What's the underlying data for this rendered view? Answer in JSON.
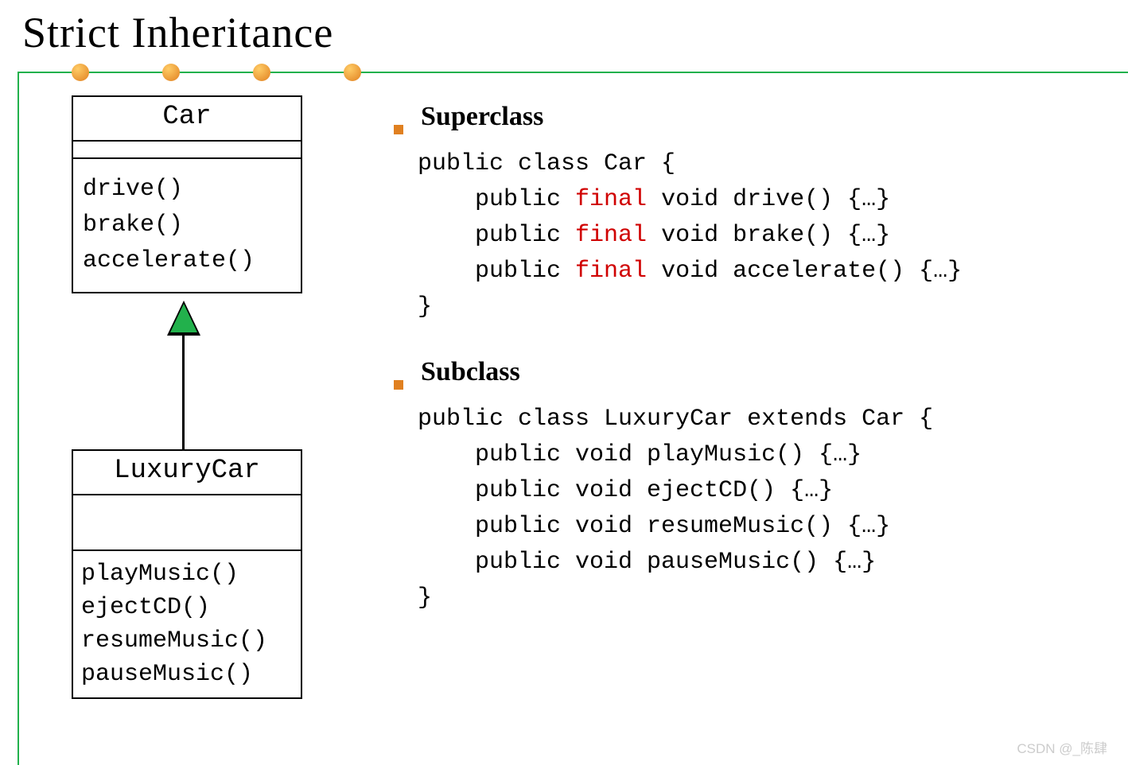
{
  "title": "Strict  Inheritance",
  "uml": {
    "car": {
      "name": "Car",
      "methods": [
        "drive()",
        "brake()",
        "accelerate()"
      ]
    },
    "luxury": {
      "name": "LuxuryCar",
      "methods": [
        "playMusic()",
        "ejectCD()",
        "resumeMusic()",
        "pauseMusic()"
      ]
    }
  },
  "sections": {
    "superclass": {
      "heading": "Superclass",
      "code": {
        "l1": "public class Car {",
        "l2a": "    public ",
        "l2b": "final",
        "l2c": " void drive() {…}",
        "l3a": "    public ",
        "l3b": "final",
        "l3c": " void brake() {…}",
        "l4a": "    public ",
        "l4b": "final",
        "l4c": " void accelerate() {…}",
        "l5": "}"
      }
    },
    "subclass": {
      "heading": "Subclass",
      "code": {
        "l1": "public class LuxuryCar extends Car {",
        "l2": "    public void playMusic() {…}",
        "l3": "    public void ejectCD() {…}",
        "l4": "    public void resumeMusic() {…}",
        "l5": "    public void pauseMusic() {…}",
        "l6": "}"
      }
    }
  },
  "watermark": "CSDN @_陈肆",
  "chart_data": {
    "type": "diagram",
    "description": "UML class inheritance diagram",
    "classes": [
      {
        "name": "Car",
        "stereotype": "superclass",
        "methods": [
          "drive()",
          "brake()",
          "accelerate()"
        ],
        "method_modifier": "final"
      },
      {
        "name": "LuxuryCar",
        "stereotype": "subclass",
        "extends": "Car",
        "methods": [
          "playMusic()",
          "ejectCD()",
          "resumeMusic()",
          "pauseMusic()"
        ]
      }
    ],
    "relationships": [
      {
        "from": "LuxuryCar",
        "to": "Car",
        "type": "inheritance"
      }
    ]
  }
}
